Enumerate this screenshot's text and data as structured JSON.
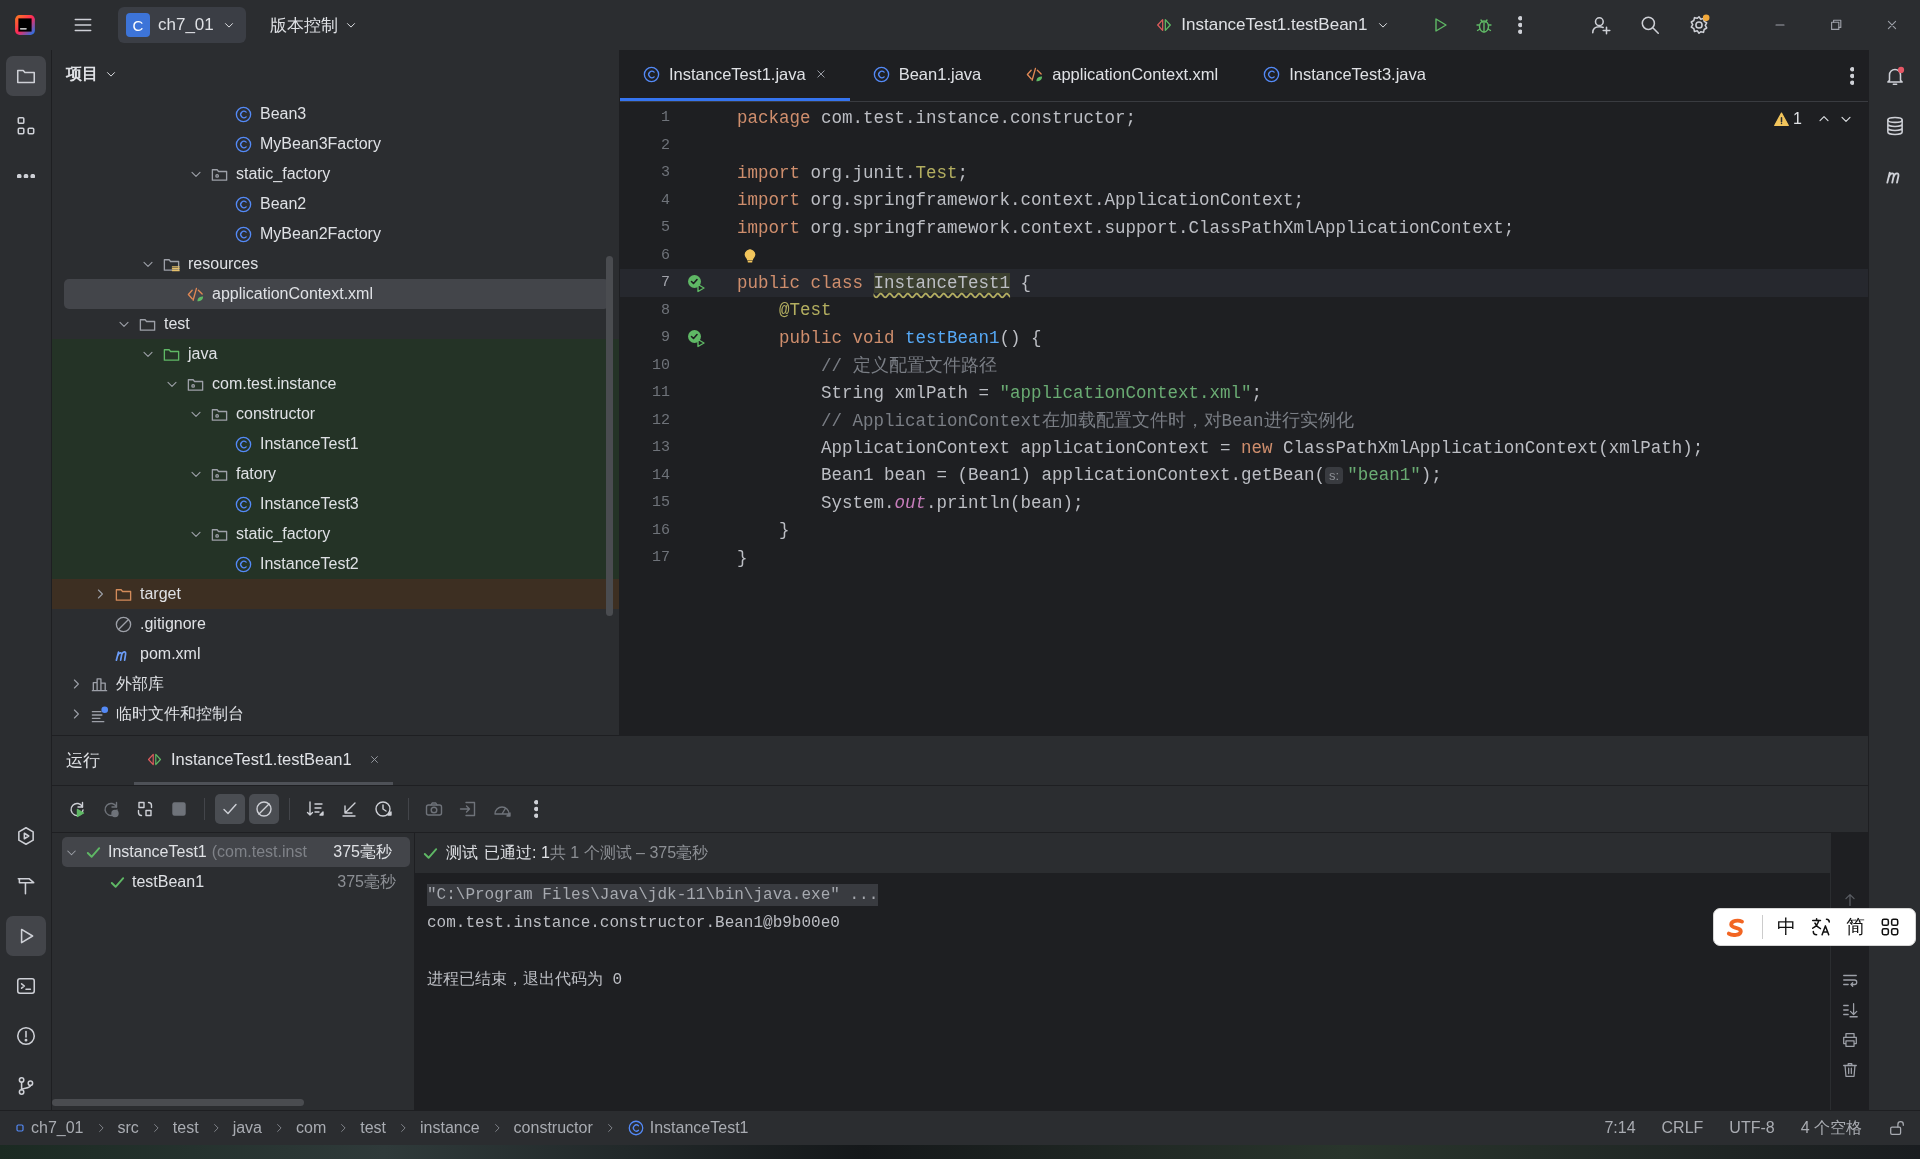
{
  "title_bar": {
    "project_initial": "C",
    "project": "ch7_01",
    "vcs": "版本控制",
    "run_config": "InstanceTest1.testBean1"
  },
  "left_tools": {
    "top": [
      {
        "kind": "project",
        "selected": true
      },
      {
        "kind": "structure",
        "selected": false
      },
      {
        "kind": "more",
        "selected": false
      }
    ],
    "bottom": [
      {
        "kind": "services",
        "selected": false
      },
      {
        "kind": "build",
        "selected": false
      },
      {
        "kind": "run",
        "selected": true
      },
      {
        "kind": "terminal",
        "selected": false
      },
      {
        "kind": "problems",
        "selected": false
      },
      {
        "kind": "git",
        "selected": false
      }
    ]
  },
  "right_tools": [
    {
      "kind": "notifications"
    },
    {
      "kind": "database"
    },
    {
      "kind": "maven"
    }
  ],
  "project": {
    "title": "项目",
    "tree": [
      {
        "children": [
          {
            "children": [
              {
                "children": [
                  {
                    "children": [
                      {
                        "children": [
                          {
                            "children": [
                              {
                                "label": "Bean3",
                                "kind": "class",
                                "selected": false
                              },
                              {
                                "label": "MyBean3Factory",
                                "kind": "class",
                                "selected": false
                              }
                            ]
                          },
                          {
                            "label": "static_factory",
                            "kind": "package",
                            "expanded": true,
                            "selected": false,
                            "children": [
                              {
                                "label": "Bean2",
                                "kind": "class",
                                "selected": false
                              },
                              {
                                "label": "MyBean2Factory",
                                "kind": "class",
                                "selected": false
                              }
                            ]
                          }
                        ]
                      }
                    ]
                  },
                  {
                    "label": "resources",
                    "kind": "resources",
                    "expanded": true,
                    "selected": false,
                    "children": [
                      {
                        "label": "applicationContext.xml",
                        "kind": "xml",
                        "selected": true
                      }
                    ]
                  }
                ]
              },
              {
                "label": "test",
                "kind": "folder",
                "expanded": true,
                "selected": false,
                "children": [
                  {
                    "label": "java",
                    "kind": "test-source",
                    "expanded": true,
                    "selected": false,
                    "color": "#243326",
                    "children": [
                      {
                        "label": "com.test.instance",
                        "kind": "package",
                        "expanded": true,
                        "selected": false,
                        "children": [
                          {
                            "label": "constructor",
                            "kind": "package",
                            "expanded": true,
                            "selected": false,
                            "children": [
                              {
                                "label": "InstanceTest1",
                                "kind": "class",
                                "selected": false
                              }
                            ]
                          },
                          {
                            "label": "fatory",
                            "kind": "package",
                            "expanded": true,
                            "selected": false,
                            "children": [
                              {
                                "label": "InstanceTest3",
                                "kind": "class",
                                "selected": false
                              }
                            ]
                          },
                          {
                            "label": "static_factory",
                            "kind": "package",
                            "expanded": true,
                            "selected": false,
                            "children": [
                              {
                                "label": "InstanceTest2",
                                "kind": "class",
                                "selected": false
                              }
                            ]
                          }
                        ]
                      }
                    ]
                  }
                ]
              }
            ]
          },
          {
            "label": "target",
            "kind": "excluded",
            "expanded": false,
            "selected": false,
            "color": "#3d2f22"
          },
          {
            "label": ".gitignore",
            "kind": "ignore",
            "selected": false
          },
          {
            "label": "pom.xml",
            "kind": "maven",
            "selected": false
          }
        ]
      },
      {
        "label": "外部库",
        "kind": "library",
        "expanded": false,
        "selected": false
      },
      {
        "label": "临时文件和控制台",
        "kind": "scratch",
        "expanded": false,
        "selected": false
      }
    ]
  },
  "editor": {
    "tabs": [
      {
        "label": "InstanceTest1.java",
        "kind": "class",
        "selected": true
      },
      {
        "label": "Bean1.java",
        "kind": "class",
        "selected": false
      },
      {
        "label": "applicationContext.xml",
        "kind": "xml",
        "selected": false
      },
      {
        "label": "InstanceTest3.java",
        "kind": "class",
        "selected": false
      }
    ],
    "warnings": "1",
    "lines": [
      {
        "number": "1",
        "current": false,
        "tokens": [
          {
            "text": "package",
            "kind": "kw"
          },
          {
            "text": " com.test.instance.constructor;",
            "kind": "plain"
          }
        ]
      },
      {
        "number": "2",
        "current": false
      },
      {
        "number": "3",
        "current": false,
        "tokens": [
          {
            "text": "import",
            "kind": "kw"
          },
          {
            "text": " org.junit.",
            "kind": "plain"
          },
          {
            "text": "Test",
            "kind": "ann"
          },
          {
            "text": ";",
            "kind": "plain"
          }
        ]
      },
      {
        "number": "4",
        "current": false,
        "tokens": [
          {
            "text": "import",
            "kind": "kw"
          },
          {
            "text": " org.springframework.context.ApplicationContext;",
            "kind": "plain"
          }
        ]
      },
      {
        "number": "5",
        "current": false,
        "tokens": [
          {
            "text": "import",
            "kind": "kw"
          },
          {
            "text": " org.springframework.context.support.ClassPathXmlApplicationContext;",
            "kind": "plain"
          }
        ]
      },
      {
        "number": "6",
        "current": false,
        "bulb": true
      },
      {
        "number": "7",
        "current": true,
        "test_passed": true,
        "tokens": [
          {
            "text": "public class ",
            "kind": "kw"
          },
          {
            "text": "InstanceTest1",
            "kind": "warn"
          },
          {
            "text": " {",
            "kind": "plain"
          }
        ]
      },
      {
        "number": "8",
        "current": false,
        "tokens": [
          {
            "text": "    @Test",
            "kind": "ann"
          }
        ]
      },
      {
        "number": "9",
        "current": false,
        "test_passed": true,
        "tokens": [
          {
            "text": "    public void ",
            "kind": "kw"
          },
          {
            "text": "testBean1",
            "kind": "fn"
          },
          {
            "text": "() {",
            "kind": "plain"
          }
        ]
      },
      {
        "number": "10",
        "current": false,
        "tokens": [
          {
            "text": "        // 定义配置文件路径",
            "kind": "cm"
          }
        ]
      },
      {
        "number": "11",
        "current": false,
        "tokens": [
          {
            "text": "        String xmlPath = ",
            "kind": "plain"
          },
          {
            "text": "\"applicationContext.xml\"",
            "kind": "str"
          },
          {
            "text": ";",
            "kind": "plain"
          }
        ]
      },
      {
        "number": "12",
        "current": false,
        "tokens": [
          {
            "text": "        // ApplicationContext在加载配置文件时，对Bean进行实例化",
            "kind": "cm"
          }
        ]
      },
      {
        "number": "13",
        "current": false,
        "tokens": [
          {
            "text": "        ApplicationContext applicationContext = ",
            "kind": "plain"
          },
          {
            "text": "new",
            "kind": "kw"
          },
          {
            "text": " ClassPathXmlApplicationContext(xmlPath);",
            "kind": "plain"
          }
        ]
      },
      {
        "number": "14",
        "current": false,
        "tokens": [
          {
            "text": "        Bean1 bean = (Bean1) applicationContext.getBean(",
            "kind": "plain"
          },
          {
            "text": "s:",
            "kind": "hint"
          },
          {
            "text": "\"bean1\"",
            "kind": "str"
          },
          {
            "text": ");",
            "kind": "plain"
          }
        ]
      },
      {
        "number": "15",
        "current": false,
        "tokens": [
          {
            "text": "        System.",
            "kind": "plain"
          },
          {
            "text": "out",
            "kind": "field"
          },
          {
            "text": ".println(bean);",
            "kind": "plain"
          }
        ]
      },
      {
        "number": "16",
        "current": false,
        "tokens": [
          {
            "text": "    }",
            "kind": "plain"
          }
        ]
      },
      {
        "number": "17",
        "current": false,
        "tokens": [
          {
            "text": "}",
            "kind": "plain"
          }
        ]
      }
    ]
  },
  "run": {
    "title": "运行",
    "tab": {
      "label": "InstanceTest1.testBean1",
      "selected": true
    },
    "toolbar": [
      {
        "kind": "rerun",
        "disabled": false,
        "selected": false
      },
      {
        "kind": "rerun-failed",
        "disabled": true,
        "selected": false
      },
      {
        "kind": "toggle-auto",
        "disabled": false,
        "selected": false
      },
      {
        "kind": "stop",
        "disabled": true,
        "selected": false
      },
      {
        "kind": "sep"
      },
      {
        "kind": "show-passed",
        "disabled": false,
        "selected": true
      },
      {
        "kind": "show-ignored",
        "disabled": false,
        "selected": true
      },
      {
        "kind": "sep"
      },
      {
        "kind": "sort",
        "disabled": false,
        "selected": false
      },
      {
        "kind": "collapse",
        "disabled": false,
        "selected": false
      },
      {
        "kind": "history",
        "disabled": false,
        "selected": false
      },
      {
        "kind": "sep"
      },
      {
        "kind": "camera",
        "disabled": true,
        "selected": false
      },
      {
        "kind": "export",
        "disabled": true,
        "selected": false
      },
      {
        "kind": "gauge",
        "disabled": true,
        "selected": false
      },
      {
        "kind": "more",
        "disabled": false,
        "selected": false
      }
    ],
    "tests": [
      {
        "label": "InstanceTest1",
        "package": "(com.test.inst",
        "time": "375毫秒",
        "passed": true,
        "expanded": true,
        "selected": true,
        "children": [
          {
            "label": "testBean1",
            "time": "375毫秒",
            "passed": true,
            "selected": false
          }
        ]
      }
    ],
    "summary": {
      "passed": true,
      "label": "测试",
      "result": "已通过: 1",
      "total": "共 1 个测试 – 375毫秒"
    },
    "console": [
      {
        "kind": "command",
        "text": "\"C:\\Program Files\\Java\\jdk-11\\bin\\java.exe\" ..."
      },
      {
        "kind": "output",
        "text": "com.test.instance.constructor.Bean1@b9b00e0"
      },
      {
        "kind": "exit",
        "text": "进程已结束，退出代码为 0"
      }
    ]
  },
  "status_bar": {
    "breadcrumbs": [
      {
        "label": "ch7_01",
        "kind": "module"
      },
      {
        "label": "src",
        "kind": "folder"
      },
      {
        "label": "test",
        "kind": "folder"
      },
      {
        "label": "java",
        "kind": "folder"
      },
      {
        "label": "com",
        "kind": "folder"
      },
      {
        "label": "test",
        "kind": "folder"
      },
      {
        "label": "instance",
        "kind": "folder"
      },
      {
        "label": "constructor",
        "kind": "folder"
      },
      {
        "label": "InstanceTest1",
        "kind": "class"
      }
    ],
    "items": [
      "7:14",
      "CRLF",
      "UTF-8",
      "4 个空格"
    ]
  },
  "ime_toolbar": {
    "mode": "中",
    "script": "简"
  }
}
